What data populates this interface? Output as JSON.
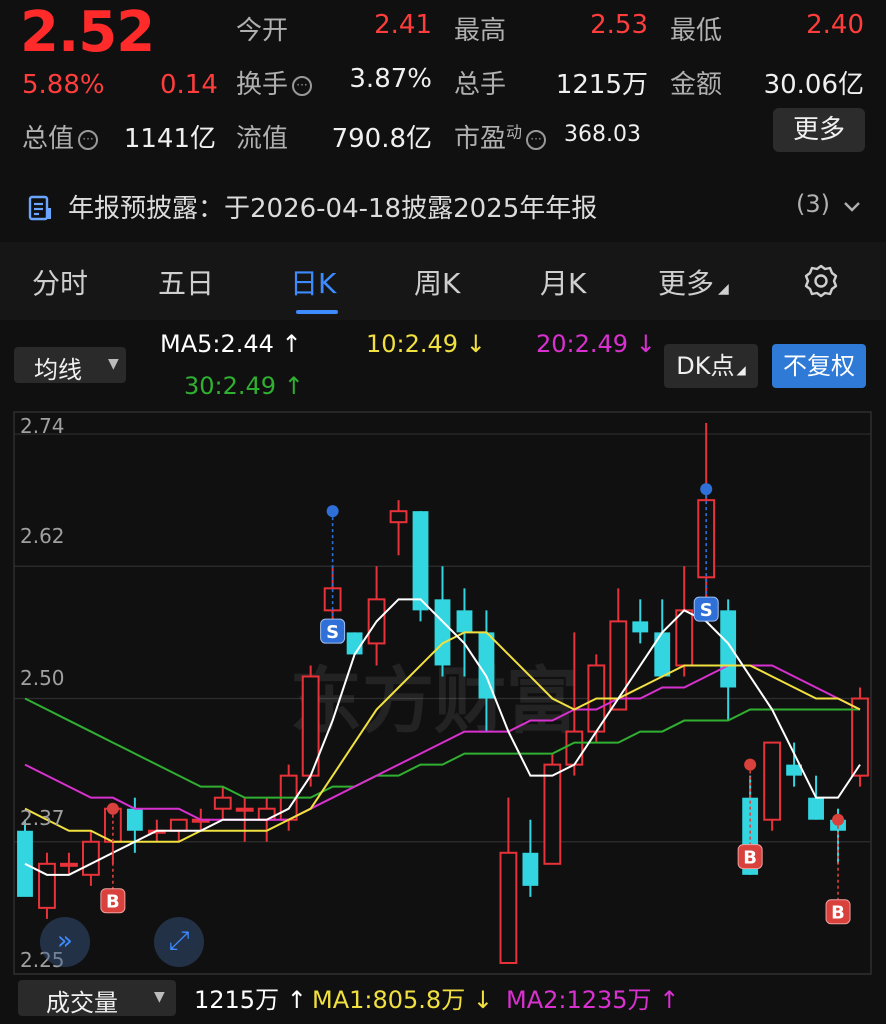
{
  "quote": {
    "price": "2.52",
    "change_pct": "5.88%",
    "change": "0.14",
    "open_label": "今开",
    "open": "2.41",
    "high_label": "最高",
    "high": "2.53",
    "low_label": "最低",
    "low": "2.40",
    "turnover_label": "换手",
    "turnover": "3.87%",
    "volume_label": "总手",
    "volume": "1215万",
    "amount_label": "金额",
    "amount": "30.06亿",
    "mktcap_label": "总值",
    "mktcap": "1141亿",
    "float_label": "流值",
    "float": "790.8亿",
    "pe_label": "市盈",
    "pe_sup": "动",
    "pe": "368.03",
    "more_label": "更多"
  },
  "disclosure": {
    "text": "年报预披露：于2026-04-18披露2025年年报",
    "count": "(3)"
  },
  "tabs": [
    "分时",
    "五日",
    "日K",
    "周K",
    "月K",
    "更多"
  ],
  "active_tab": "日K",
  "indicators": {
    "selector": "均线",
    "ma5": "MA5:2.44",
    "ma10": "10:2.49",
    "ma20": "20:2.49",
    "ma30": "30:2.49",
    "dk_label": "DK点",
    "restore_label": "不复权"
  },
  "axis": {
    "y_labels": [
      "2.74",
      "2.62",
      "2.50",
      "2.37",
      "2.25"
    ]
  },
  "volume_bar": {
    "selector": "成交量",
    "volume": "1215万",
    "ma1": "MA1:805.8万",
    "ma2": "MA2:1235万"
  },
  "colors": {
    "up": "#e8323a",
    "down": "#33d6e0",
    "ma5": "#ffffff",
    "ma10": "#f0e040",
    "ma20": "#d930d0",
    "ma30": "#2fb030",
    "accent": "#3d8bff"
  },
  "chart_data": {
    "type": "candlestick",
    "ylim": [
      2.25,
      2.76
    ],
    "candles": [
      {
        "o": 2.38,
        "h": 2.39,
        "l": 2.33,
        "c": 2.32
      },
      {
        "o": 2.31,
        "h": 2.36,
        "l": 2.3,
        "c": 2.35
      },
      {
        "o": 2.35,
        "h": 2.36,
        "l": 2.34,
        "c": 2.35
      },
      {
        "o": 2.34,
        "h": 2.38,
        "l": 2.33,
        "c": 2.37
      },
      {
        "o": 2.37,
        "h": 2.4,
        "l": 2.35,
        "c": 2.4
      },
      {
        "o": 2.4,
        "h": 2.41,
        "l": 2.36,
        "c": 2.38
      },
      {
        "o": 2.38,
        "h": 2.39,
        "l": 2.37,
        "c": 2.38
      },
      {
        "o": 2.38,
        "h": 2.39,
        "l": 2.37,
        "c": 2.39
      },
      {
        "o": 2.39,
        "h": 2.4,
        "l": 2.38,
        "c": 2.39
      },
      {
        "o": 2.4,
        "h": 2.42,
        "l": 2.39,
        "c": 2.41
      },
      {
        "o": 2.4,
        "h": 2.41,
        "l": 2.37,
        "c": 2.4
      },
      {
        "o": 2.39,
        "h": 2.41,
        "l": 2.37,
        "c": 2.4
      },
      {
        "o": 2.39,
        "h": 2.44,
        "l": 2.38,
        "c": 2.43
      },
      {
        "o": 2.43,
        "h": 2.53,
        "l": 2.42,
        "c": 2.52
      },
      {
        "o": 2.58,
        "h": 2.62,
        "l": 2.55,
        "c": 2.6
      },
      {
        "o": 2.56,
        "h": 2.56,
        "l": 2.54,
        "c": 2.54
      },
      {
        "o": 2.55,
        "h": 2.62,
        "l": 2.53,
        "c": 2.59
      },
      {
        "o": 2.66,
        "h": 2.68,
        "l": 2.63,
        "c": 2.67
      },
      {
        "o": 2.67,
        "h": 2.67,
        "l": 2.57,
        "c": 2.58
      },
      {
        "o": 2.59,
        "h": 2.62,
        "l": 2.52,
        "c": 2.53
      },
      {
        "o": 2.58,
        "h": 2.6,
        "l": 2.52,
        "c": 2.56
      },
      {
        "o": 2.56,
        "h": 2.58,
        "l": 2.47,
        "c": 2.5
      },
      {
        "o": 2.26,
        "h": 2.41,
        "l": 2.26,
        "c": 2.36
      },
      {
        "o": 2.36,
        "h": 2.39,
        "l": 2.32,
        "c": 2.33
      },
      {
        "o": 2.35,
        "h": 2.45,
        "l": 2.35,
        "c": 2.44
      },
      {
        "o": 2.44,
        "h": 2.56,
        "l": 2.43,
        "c": 2.47
      },
      {
        "o": 2.47,
        "h": 2.54,
        "l": 2.46,
        "c": 2.53
      },
      {
        "o": 2.49,
        "h": 2.6,
        "l": 2.49,
        "c": 2.57
      },
      {
        "o": 2.57,
        "h": 2.59,
        "l": 2.55,
        "c": 2.56
      },
      {
        "o": 2.56,
        "h": 2.59,
        "l": 2.52,
        "c": 2.52
      },
      {
        "o": 2.53,
        "h": 2.62,
        "l": 2.52,
        "c": 2.58
      },
      {
        "o": 2.61,
        "h": 2.75,
        "l": 2.58,
        "c": 2.68
      },
      {
        "o": 2.58,
        "h": 2.59,
        "l": 2.48,
        "c": 2.51
      },
      {
        "o": 2.41,
        "h": 2.43,
        "l": 2.34,
        "c": 2.34
      },
      {
        "o": 2.39,
        "h": 2.46,
        "l": 2.38,
        "c": 2.46
      },
      {
        "o": 2.44,
        "h": 2.46,
        "l": 2.42,
        "c": 2.43
      },
      {
        "o": 2.41,
        "h": 2.43,
        "l": 2.39,
        "c": 2.39
      },
      {
        "o": 2.39,
        "h": 2.4,
        "l": 2.35,
        "c": 2.38
      },
      {
        "o": 2.43,
        "h": 2.51,
        "l": 2.42,
        "c": 2.5
      }
    ],
    "ma5": [
      2.35,
      2.34,
      2.34,
      2.35,
      2.36,
      2.37,
      2.38,
      2.38,
      2.38,
      2.39,
      2.39,
      2.39,
      2.4,
      2.43,
      2.48,
      2.54,
      2.57,
      2.59,
      2.59,
      2.57,
      2.55,
      2.52,
      2.47,
      2.43,
      2.43,
      2.44,
      2.47,
      2.5,
      2.53,
      2.56,
      2.58,
      2.57,
      2.55,
      2.52,
      2.49,
      2.45,
      2.41,
      2.41,
      2.44
    ],
    "ma10": [
      2.4,
      2.39,
      2.38,
      2.38,
      2.37,
      2.37,
      2.37,
      2.37,
      2.38,
      2.38,
      2.38,
      2.38,
      2.39,
      2.4,
      2.43,
      2.46,
      2.49,
      2.51,
      2.53,
      2.55,
      2.56,
      2.56,
      2.54,
      2.52,
      2.5,
      2.49,
      2.5,
      2.5,
      2.51,
      2.52,
      2.53,
      2.53,
      2.53,
      2.53,
      2.52,
      2.51,
      2.5,
      2.5,
      2.49
    ],
    "ma20": [
      2.44,
      2.43,
      2.42,
      2.41,
      2.41,
      2.4,
      2.4,
      2.4,
      2.39,
      2.39,
      2.39,
      2.39,
      2.39,
      2.4,
      2.41,
      2.42,
      2.43,
      2.44,
      2.45,
      2.46,
      2.47,
      2.47,
      2.47,
      2.48,
      2.48,
      2.49,
      2.49,
      2.5,
      2.5,
      2.51,
      2.51,
      2.52,
      2.53,
      2.53,
      2.53,
      2.52,
      2.51,
      2.5,
      2.49
    ],
    "ma30": [
      2.5,
      2.49,
      2.48,
      2.47,
      2.46,
      2.45,
      2.44,
      2.43,
      2.42,
      2.42,
      2.41,
      2.41,
      2.41,
      2.41,
      2.42,
      2.42,
      2.43,
      2.43,
      2.44,
      2.44,
      2.45,
      2.45,
      2.45,
      2.45,
      2.45,
      2.46,
      2.46,
      2.46,
      2.47,
      2.47,
      2.48,
      2.48,
      2.48,
      2.49,
      2.49,
      2.49,
      2.49,
      2.49,
      2.49
    ],
    "signals": [
      {
        "i": 4,
        "type": "B",
        "at": 2.4
      },
      {
        "i": 14,
        "type": "S",
        "at": 2.67
      },
      {
        "i": 31,
        "type": "S",
        "at": 2.69
      },
      {
        "i": 33,
        "type": "B",
        "at": 2.44
      },
      {
        "i": 37,
        "type": "B",
        "at": 2.39
      }
    ]
  }
}
